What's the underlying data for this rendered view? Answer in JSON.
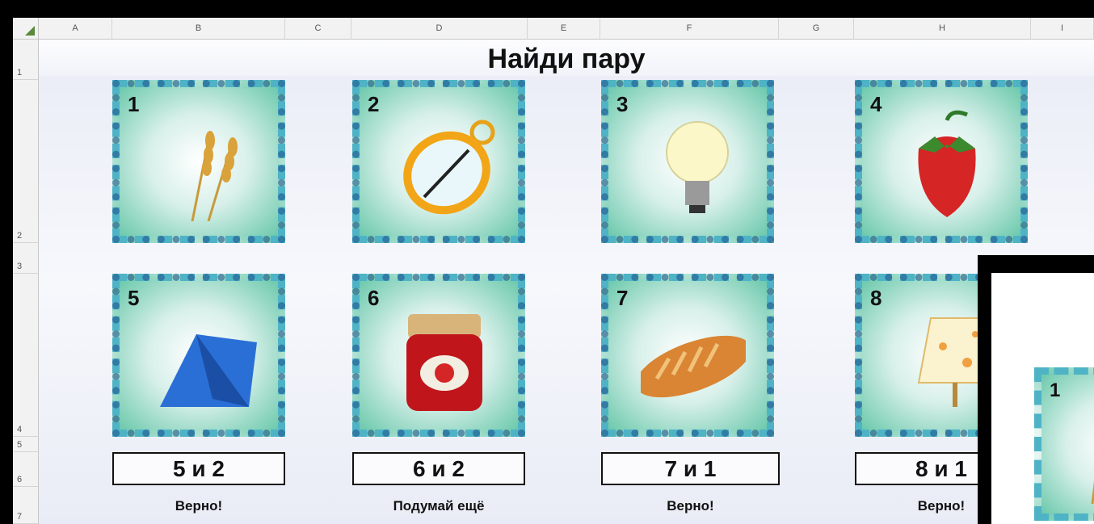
{
  "columns": [
    "A",
    "B",
    "C",
    "D",
    "E",
    "F",
    "G",
    "H",
    "I"
  ],
  "rows": [
    "1",
    "2",
    "3",
    "4",
    "5",
    "6",
    "7"
  ],
  "title": "Найди пару",
  "cards": [
    {
      "number": "1",
      "icon": "wheat-icon"
    },
    {
      "number": "2",
      "icon": "compass-icon"
    },
    {
      "number": "3",
      "icon": "lightbulb-icon"
    },
    {
      "number": "4",
      "icon": "strawberry-icon"
    },
    {
      "number": "5",
      "icon": "tent-icon"
    },
    {
      "number": "6",
      "icon": "jam-jar-icon"
    },
    {
      "number": "7",
      "icon": "bread-icon"
    },
    {
      "number": "8",
      "icon": "lamp-icon"
    }
  ],
  "answers": [
    {
      "pair": "5 и 2",
      "result": "Верно!"
    },
    {
      "pair": "6 и 2",
      "result": "Подумай ещё"
    },
    {
      "pair": "7 и 1",
      "result": "Верно!"
    },
    {
      "pair": "8 и 1",
      "result": "Верно!"
    }
  ],
  "overlay_card": {
    "number": "1",
    "icon": "wheat-icon"
  },
  "colors": {
    "card_frame": "#4fb3c6",
    "card_bg": "#6cc9ac",
    "answer_border": "#111111"
  }
}
